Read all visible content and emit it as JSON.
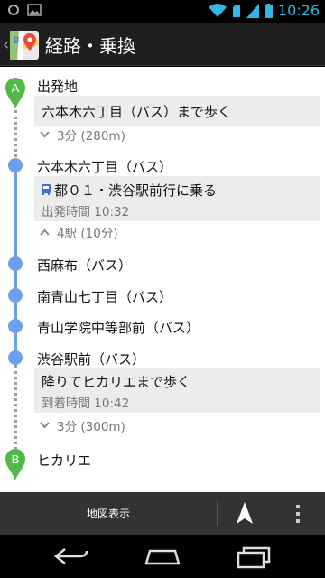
{
  "status_bar": {
    "time": "10:26",
    "icons": [
      "circle-icon",
      "image-icon",
      "wifi-icon",
      "sim-icon",
      "signal-icon",
      "battery-icon"
    ]
  },
  "action_bar": {
    "back_caret": "‹",
    "app_icon": "maps-icon",
    "title": "経路・乗換"
  },
  "route": {
    "start": {
      "marker": "A",
      "label": "出発地",
      "walk_card": "六本木六丁目（バス）まで歩く",
      "walk_summary": "3分 (280m)"
    },
    "board_stop": {
      "label": "六本木六丁目（バス）",
      "bus_card_title": "都０１・渋谷駅前行に乗る",
      "bus_card_sub": "出発時間 10:32",
      "stops_summary": "4駅 (10分)"
    },
    "intermediate_stops": [
      "西麻布（バス）",
      "南青山七丁目（バス）",
      "青山学院中等部前（バス）"
    ],
    "alight_stop": {
      "label": "渋谷駅前（バス）",
      "walk_card": "降りてヒカリエまで歩く",
      "walk_card_sub": "到着時間 10:42",
      "walk_summary": "3分 (300m)"
    },
    "end": {
      "marker": "B",
      "label": "ヒカリエ"
    }
  },
  "colors": {
    "route_blue": "#6aa0f0",
    "marker_green": "#52b848",
    "holo_blue": "#33b5e5"
  },
  "bottom_bar": {
    "map_label": "地図表示",
    "navigate_icon": "navigation-arrow-icon",
    "overflow_icon": "overflow-menu-icon"
  },
  "nav_bar": {
    "back_icon": "back-icon",
    "home_icon": "home-icon",
    "recents_icon": "recents-icon"
  }
}
